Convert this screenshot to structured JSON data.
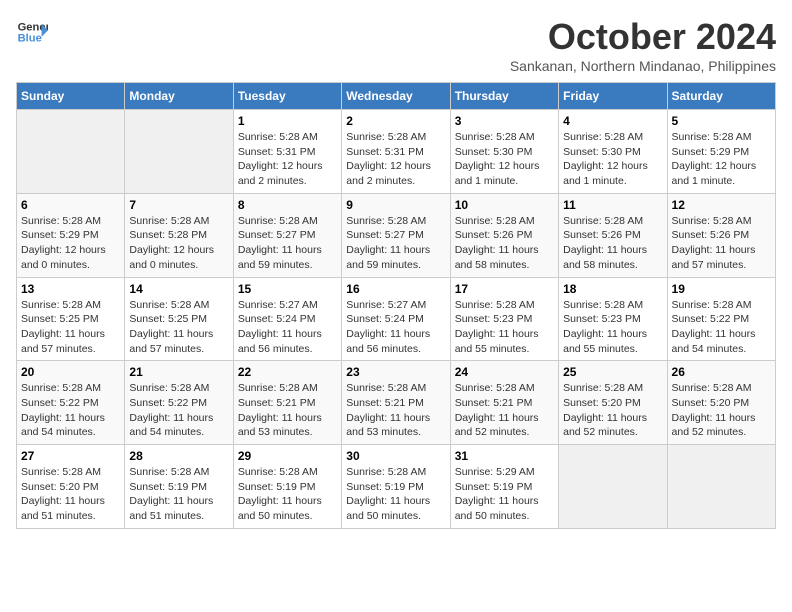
{
  "header": {
    "logo_line1": "General",
    "logo_line2": "Blue",
    "month_title": "October 2024",
    "subtitle": "Sankanan, Northern Mindanao, Philippines"
  },
  "weekdays": [
    "Sunday",
    "Monday",
    "Tuesday",
    "Wednesday",
    "Thursday",
    "Friday",
    "Saturday"
  ],
  "weeks": [
    [
      {
        "day": "",
        "sunrise": "",
        "sunset": "",
        "daylight": ""
      },
      {
        "day": "",
        "sunrise": "",
        "sunset": "",
        "daylight": ""
      },
      {
        "day": "1",
        "sunrise": "Sunrise: 5:28 AM",
        "sunset": "Sunset: 5:31 PM",
        "daylight": "Daylight: 12 hours and 2 minutes."
      },
      {
        "day": "2",
        "sunrise": "Sunrise: 5:28 AM",
        "sunset": "Sunset: 5:31 PM",
        "daylight": "Daylight: 12 hours and 2 minutes."
      },
      {
        "day": "3",
        "sunrise": "Sunrise: 5:28 AM",
        "sunset": "Sunset: 5:30 PM",
        "daylight": "Daylight: 12 hours and 1 minute."
      },
      {
        "day": "4",
        "sunrise": "Sunrise: 5:28 AM",
        "sunset": "Sunset: 5:30 PM",
        "daylight": "Daylight: 12 hours and 1 minute."
      },
      {
        "day": "5",
        "sunrise": "Sunrise: 5:28 AM",
        "sunset": "Sunset: 5:29 PM",
        "daylight": "Daylight: 12 hours and 1 minute."
      }
    ],
    [
      {
        "day": "6",
        "sunrise": "Sunrise: 5:28 AM",
        "sunset": "Sunset: 5:29 PM",
        "daylight": "Daylight: 12 hours and 0 minutes."
      },
      {
        "day": "7",
        "sunrise": "Sunrise: 5:28 AM",
        "sunset": "Sunset: 5:28 PM",
        "daylight": "Daylight: 12 hours and 0 minutes."
      },
      {
        "day": "8",
        "sunrise": "Sunrise: 5:28 AM",
        "sunset": "Sunset: 5:27 PM",
        "daylight": "Daylight: 11 hours and 59 minutes."
      },
      {
        "day": "9",
        "sunrise": "Sunrise: 5:28 AM",
        "sunset": "Sunset: 5:27 PM",
        "daylight": "Daylight: 11 hours and 59 minutes."
      },
      {
        "day": "10",
        "sunrise": "Sunrise: 5:28 AM",
        "sunset": "Sunset: 5:26 PM",
        "daylight": "Daylight: 11 hours and 58 minutes."
      },
      {
        "day": "11",
        "sunrise": "Sunrise: 5:28 AM",
        "sunset": "Sunset: 5:26 PM",
        "daylight": "Daylight: 11 hours and 58 minutes."
      },
      {
        "day": "12",
        "sunrise": "Sunrise: 5:28 AM",
        "sunset": "Sunset: 5:26 PM",
        "daylight": "Daylight: 11 hours and 57 minutes."
      }
    ],
    [
      {
        "day": "13",
        "sunrise": "Sunrise: 5:28 AM",
        "sunset": "Sunset: 5:25 PM",
        "daylight": "Daylight: 11 hours and 57 minutes."
      },
      {
        "day": "14",
        "sunrise": "Sunrise: 5:28 AM",
        "sunset": "Sunset: 5:25 PM",
        "daylight": "Daylight: 11 hours and 57 minutes."
      },
      {
        "day": "15",
        "sunrise": "Sunrise: 5:27 AM",
        "sunset": "Sunset: 5:24 PM",
        "daylight": "Daylight: 11 hours and 56 minutes."
      },
      {
        "day": "16",
        "sunrise": "Sunrise: 5:27 AM",
        "sunset": "Sunset: 5:24 PM",
        "daylight": "Daylight: 11 hours and 56 minutes."
      },
      {
        "day": "17",
        "sunrise": "Sunrise: 5:28 AM",
        "sunset": "Sunset: 5:23 PM",
        "daylight": "Daylight: 11 hours and 55 minutes."
      },
      {
        "day": "18",
        "sunrise": "Sunrise: 5:28 AM",
        "sunset": "Sunset: 5:23 PM",
        "daylight": "Daylight: 11 hours and 55 minutes."
      },
      {
        "day": "19",
        "sunrise": "Sunrise: 5:28 AM",
        "sunset": "Sunset: 5:22 PM",
        "daylight": "Daylight: 11 hours and 54 minutes."
      }
    ],
    [
      {
        "day": "20",
        "sunrise": "Sunrise: 5:28 AM",
        "sunset": "Sunset: 5:22 PM",
        "daylight": "Daylight: 11 hours and 54 minutes."
      },
      {
        "day": "21",
        "sunrise": "Sunrise: 5:28 AM",
        "sunset": "Sunset: 5:22 PM",
        "daylight": "Daylight: 11 hours and 54 minutes."
      },
      {
        "day": "22",
        "sunrise": "Sunrise: 5:28 AM",
        "sunset": "Sunset: 5:21 PM",
        "daylight": "Daylight: 11 hours and 53 minutes."
      },
      {
        "day": "23",
        "sunrise": "Sunrise: 5:28 AM",
        "sunset": "Sunset: 5:21 PM",
        "daylight": "Daylight: 11 hours and 53 minutes."
      },
      {
        "day": "24",
        "sunrise": "Sunrise: 5:28 AM",
        "sunset": "Sunset: 5:21 PM",
        "daylight": "Daylight: 11 hours and 52 minutes."
      },
      {
        "day": "25",
        "sunrise": "Sunrise: 5:28 AM",
        "sunset": "Sunset: 5:20 PM",
        "daylight": "Daylight: 11 hours and 52 minutes."
      },
      {
        "day": "26",
        "sunrise": "Sunrise: 5:28 AM",
        "sunset": "Sunset: 5:20 PM",
        "daylight": "Daylight: 11 hours and 52 minutes."
      }
    ],
    [
      {
        "day": "27",
        "sunrise": "Sunrise: 5:28 AM",
        "sunset": "Sunset: 5:20 PM",
        "daylight": "Daylight: 11 hours and 51 minutes."
      },
      {
        "day": "28",
        "sunrise": "Sunrise: 5:28 AM",
        "sunset": "Sunset: 5:19 PM",
        "daylight": "Daylight: 11 hours and 51 minutes."
      },
      {
        "day": "29",
        "sunrise": "Sunrise: 5:28 AM",
        "sunset": "Sunset: 5:19 PM",
        "daylight": "Daylight: 11 hours and 50 minutes."
      },
      {
        "day": "30",
        "sunrise": "Sunrise: 5:28 AM",
        "sunset": "Sunset: 5:19 PM",
        "daylight": "Daylight: 11 hours and 50 minutes."
      },
      {
        "day": "31",
        "sunrise": "Sunrise: 5:29 AM",
        "sunset": "Sunset: 5:19 PM",
        "daylight": "Daylight: 11 hours and 50 minutes."
      },
      {
        "day": "",
        "sunrise": "",
        "sunset": "",
        "daylight": ""
      },
      {
        "day": "",
        "sunrise": "",
        "sunset": "",
        "daylight": ""
      }
    ]
  ]
}
